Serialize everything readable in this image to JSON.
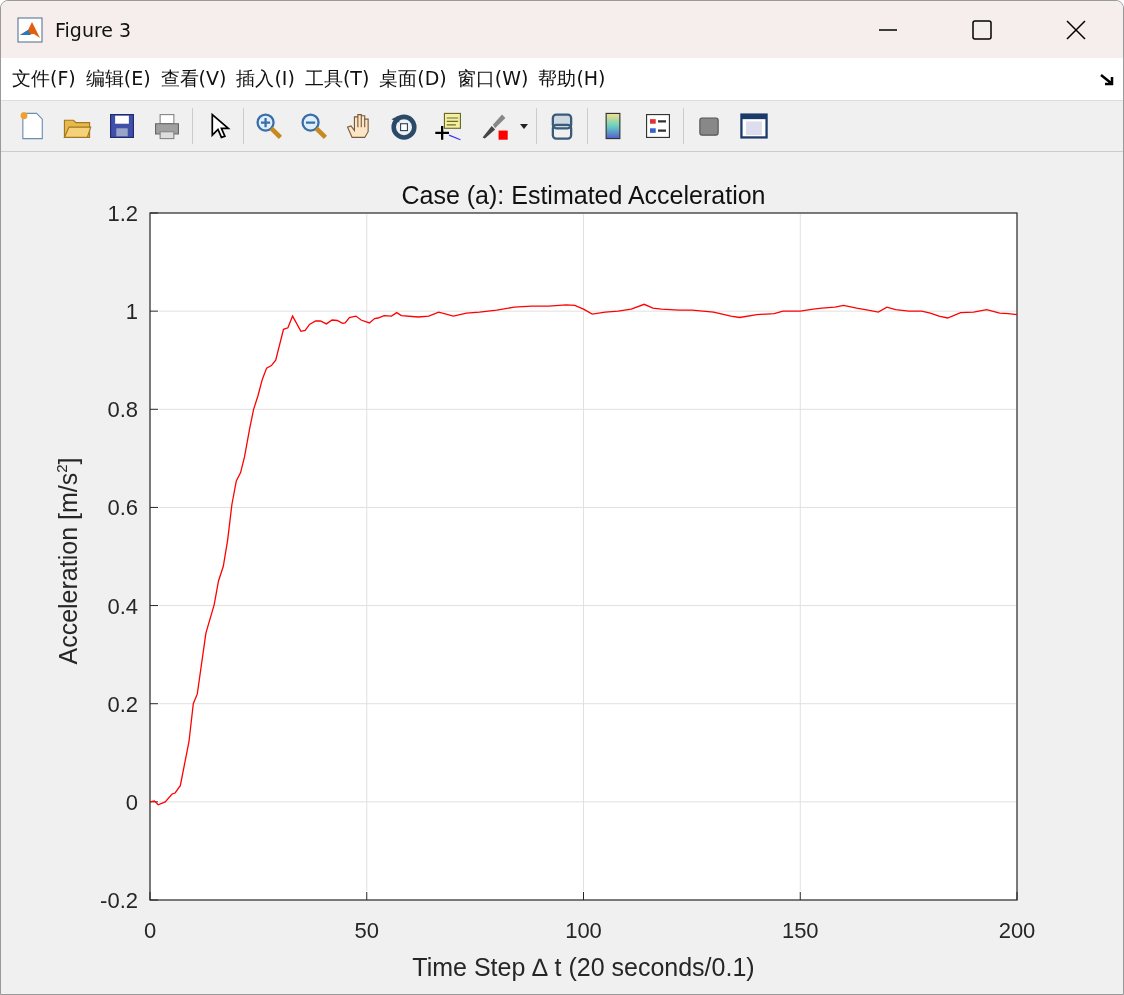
{
  "window": {
    "title": "Figure 3"
  },
  "menu": [
    {
      "label": "文件(F)"
    },
    {
      "label": "编辑(E)"
    },
    {
      "label": "查看(V)"
    },
    {
      "label": "插入(I)"
    },
    {
      "label": "工具(T)"
    },
    {
      "label": "桌面(D)"
    },
    {
      "label": "窗口(W)"
    },
    {
      "label": "帮助(H)"
    }
  ],
  "figure": {
    "chart_data": {
      "type": "line",
      "title": "Case (a): Estimated Acceleration",
      "xlabel": "Time Step ∆ t (20 seconds/0.1)",
      "ylabel": "Acceleration [m/s$^{2}$]",
      "x": [
        0,
        1,
        1.9,
        3.5,
        5.1,
        5.8,
        7,
        9,
        10,
        10.9,
        12.9,
        14.8,
        15.8,
        16.9,
        17.9,
        18.9,
        19.9,
        20.9,
        21.8,
        23,
        23.9,
        24.9,
        25.9,
        26.9,
        28,
        29,
        30.8,
        31.8,
        32.9,
        34.8,
        35.8,
        36.8,
        38.2,
        39.3,
        40.7,
        42,
        43.2,
        44.4,
        45,
        46,
        47.5,
        48.7,
        50.6,
        51.8,
        52.6,
        54,
        55.7,
        56.9,
        58,
        61.9,
        64.3,
        66.6,
        70,
        73,
        76,
        80,
        84,
        88,
        92,
        96,
        98,
        100,
        102,
        105,
        108,
        111,
        114,
        116,
        118,
        122,
        125,
        130,
        134,
        136,
        140,
        144,
        146,
        150,
        153,
        155,
        158,
        160,
        163,
        165,
        168,
        170,
        172,
        175,
        178,
        180,
        182,
        184,
        187,
        190,
        193,
        196,
        198,
        200
      ],
      "series": [
        {
          "color": "#ff0000",
          "values": [
            0.0,
            0.002,
            -0.006,
            0.0,
            0.016,
            0.018,
            0.033,
            0.123,
            0.2,
            0.22,
            0.344,
            0.402,
            0.45,
            0.48,
            0.533,
            0.606,
            0.654,
            0.671,
            0.703,
            0.761,
            0.8,
            0.827,
            0.861,
            0.884,
            0.889,
            0.9,
            0.963,
            0.966,
            0.99,
            0.959,
            0.961,
            0.973,
            0.98,
            0.98,
            0.974,
            0.982,
            0.981,
            0.975,
            0.976,
            0.987,
            0.99,
            0.982,
            0.976,
            0.985,
            0.986,
            0.991,
            0.99,
            0.997,
            0.991,
            0.988,
            0.99,
            0.998,
            0.99,
            0.996,
            0.998,
            1.002,
            1.008,
            1.01,
            1.01,
            1.013,
            1.012,
            1.004,
            0.994,
            0.998,
            1.0,
            1.004,
            1.014,
            1.006,
            1.004,
            1.002,
            1.002,
            0.998,
            0.99,
            0.987,
            0.993,
            0.995,
            1.0,
            1.0,
            1.004,
            1.006,
            1.008,
            1.012,
            1.006,
            1.003,
            0.998,
            1.008,
            1.003,
            1.0,
            1.0,
            0.996,
            0.99,
            0.986,
            0.997,
            0.998,
            1.003,
            0.996,
            0.995,
            0.993
          ]
        }
      ],
      "grid": true,
      "xlim": [
        0,
        200
      ],
      "ylim": [
        -0.2,
        1.2
      ],
      "xticks": [
        0,
        50,
        100,
        150,
        200
      ],
      "yticks": [
        -0.2,
        0,
        0.2,
        0.4,
        0.6,
        0.8,
        1,
        1.2
      ]
    }
  }
}
